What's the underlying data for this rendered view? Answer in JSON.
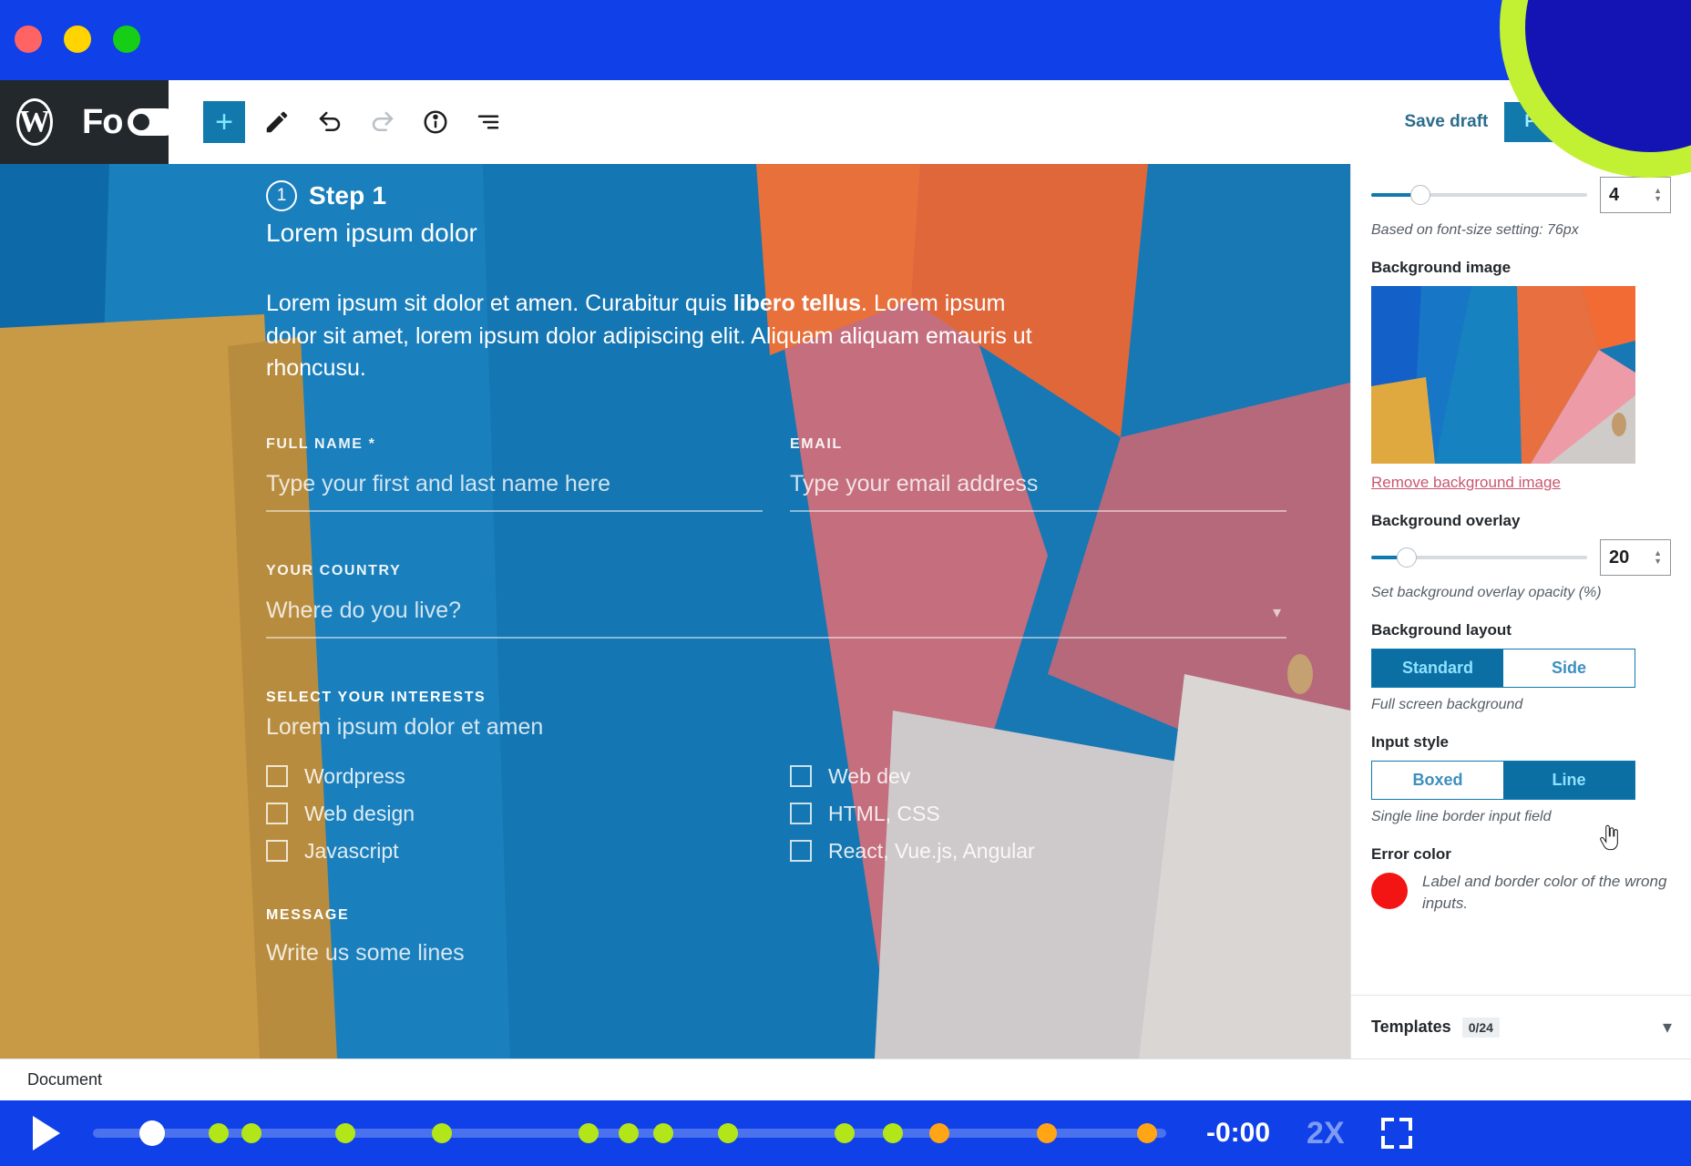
{
  "window": {
    "traffic_lights": [
      "close",
      "minimize",
      "maximize"
    ]
  },
  "toolbar": {
    "wp_logo_letter": "W",
    "brand": "Fo",
    "add_block_label": "+",
    "tools": [
      {
        "name": "add-block",
        "label": "+"
      },
      {
        "name": "edit-pencil",
        "label": "pencil"
      },
      {
        "name": "undo",
        "label": "undo"
      },
      {
        "name": "redo",
        "label": "redo"
      },
      {
        "name": "info",
        "label": "info"
      },
      {
        "name": "list-view",
        "label": "list-view"
      }
    ],
    "save_draft_label": "Save draft",
    "publish_label": "Publish",
    "settings_label": "settings"
  },
  "form": {
    "step_number": "1",
    "step_label": "Step 1",
    "step_subtitle": "Lorem ipsum dolor",
    "body_before": "Lorem ipsum sit dolor et amen. Curabitur quis ",
    "body_bold": "libero tellus",
    "body_after": ". Lorem ipsum dolor sit amet, lorem ipsum dolor adipiscing elit. Aliquam aliquam emauris ut rhoncusu.",
    "fields": [
      {
        "label": "FULL NAME *",
        "placeholder": "Type your first and last name here"
      },
      {
        "label": "EMAIL",
        "placeholder": "Type your email address"
      }
    ],
    "country": {
      "label": "YOUR COUNTRY",
      "placeholder": "Where do you live?"
    },
    "interests": {
      "title": "SELECT YOUR INTERESTS",
      "subtitle": "Lorem ipsum dolor et amen",
      "left": [
        "Wordpress",
        "Web design",
        "Javascript"
      ],
      "right": [
        "Web dev",
        "HTML, CSS",
        "React, Vue.js, Angular"
      ]
    },
    "message": {
      "label": "MESSAGE",
      "placeholder": "Write us some lines"
    }
  },
  "sidebar": {
    "columns_value": "4",
    "font_hint": "Based on font-size setting: 76px",
    "background_image_label": "Background image",
    "remove_image_label": "Remove background image",
    "overlay_label": "Background overlay",
    "overlay_value": "20",
    "overlay_hint": "Set background overlay opacity (%)",
    "layout_label": "Background layout",
    "layout_options": [
      "Standard",
      "Side"
    ],
    "layout_selected": "Standard",
    "layout_hint": "Full screen background",
    "input_style_label": "Input style",
    "input_style_options": [
      "Boxed",
      "Line"
    ],
    "input_style_selected": "Line",
    "input_style_hint": "Single line border input field",
    "error_color_label": "Error color",
    "error_color_hex": "#F31414",
    "error_color_hint": "Label and border color of the wrong inputs.",
    "templates_label": "Templates",
    "templates_badge": "0/24"
  },
  "footer": {
    "document_label": "Document"
  },
  "player": {
    "time_label": "-0:00",
    "speed_label": "2X",
    "playhead_percent": 5.5,
    "chapter_markers": [
      {
        "pos": 5.5,
        "color": "#FFFFFF"
      },
      {
        "pos": 11.7,
        "color": "#B3E619"
      },
      {
        "pos": 14.8,
        "color": "#B3E619"
      },
      {
        "pos": 23.5,
        "color": "#B3E619"
      },
      {
        "pos": 32.5,
        "color": "#B3E619"
      },
      {
        "pos": 46.2,
        "color": "#B3E619"
      },
      {
        "pos": 49.9,
        "color": "#B3E619"
      },
      {
        "pos": 53.1,
        "color": "#B3E619"
      },
      {
        "pos": 59.2,
        "color": "#B3E619"
      },
      {
        "pos": 70.0,
        "color": "#B3E619"
      },
      {
        "pos": 74.5,
        "color": "#B3E619"
      },
      {
        "pos": 78.9,
        "color": "#FFA516"
      },
      {
        "pos": 88.9,
        "color": "#FFA516"
      },
      {
        "pos": 98.2,
        "color": "#FFA516"
      }
    ]
  },
  "colors": {
    "window_blue": "#1040E8",
    "accent_blue": "#1279AC",
    "deco_green": "#C2F032",
    "deco_navy": "#1414B4"
  }
}
